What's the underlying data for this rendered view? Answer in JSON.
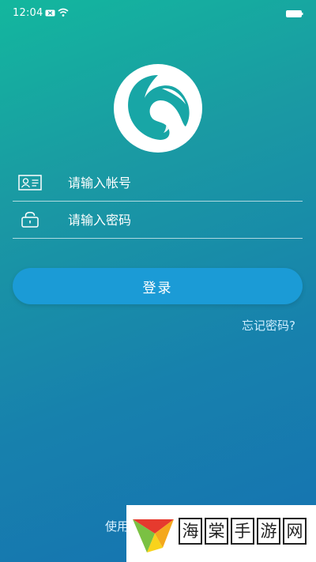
{
  "status_bar": {
    "time": "12:04"
  },
  "form": {
    "account_placeholder": "请输入帐号",
    "password_placeholder": "请输入密码",
    "login_label": "登录",
    "forgot_label": "忘记密码?"
  },
  "footer": {
    "partial_text": "使用"
  },
  "watermark": {
    "chars": [
      "海",
      "棠",
      "手",
      "游",
      "网"
    ]
  },
  "icons": {
    "sim": "sim-icon",
    "wifi": "wifi-icon",
    "battery": "battery-icon",
    "account": "id-card-icon",
    "password": "lock-icon"
  },
  "colors": {
    "gradient_start": "#13b79e",
    "gradient_end": "#1672b1",
    "button": "#1b9bd6"
  }
}
